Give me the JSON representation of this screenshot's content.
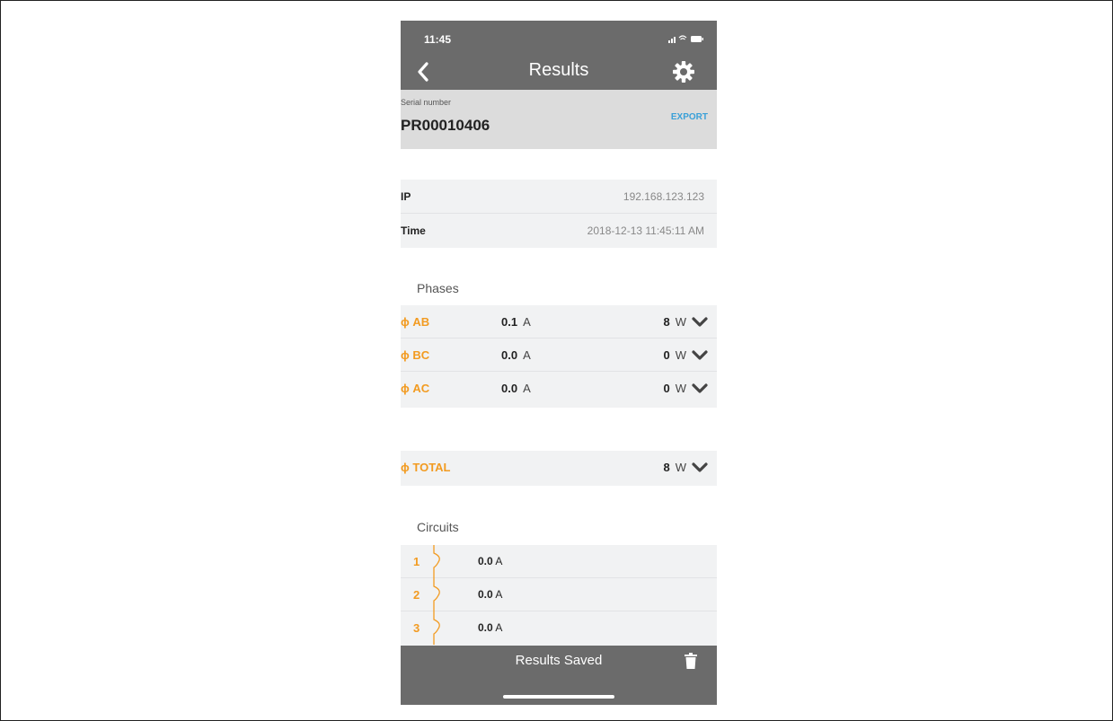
{
  "status_bar": {
    "time": "11:45"
  },
  "nav": {
    "title": "Results"
  },
  "device": {
    "serial_label": "Serial number",
    "serial_value": "PR00010406",
    "export_label": "EXPORT"
  },
  "info": [
    {
      "key": "IP",
      "value": "192.168.123.123"
    },
    {
      "key": "Time",
      "value": "2018-12-13 11:45:11 AM"
    }
  ],
  "phases": {
    "title": "Phases",
    "rows": [
      {
        "name": "AB",
        "amps": "0.1",
        "amps_unit": "A",
        "watts": "8",
        "watts_unit": "W"
      },
      {
        "name": "BC",
        "amps": "0.0",
        "amps_unit": "A",
        "watts": "0",
        "watts_unit": "W"
      },
      {
        "name": "AC",
        "amps": "0.0",
        "amps_unit": "A",
        "watts": "0",
        "watts_unit": "W"
      }
    ]
  },
  "total": {
    "name": "TOTAL",
    "watts": "8",
    "watts_unit": "W"
  },
  "circuits": {
    "title": "Circuits",
    "rows": [
      {
        "num": "1",
        "amps": "0.0",
        "unit": "A"
      },
      {
        "num": "2",
        "amps": "0.0",
        "unit": "A"
      },
      {
        "num": "3",
        "amps": "0.0",
        "unit": "A"
      }
    ]
  },
  "phase_symbol": "ϕ",
  "bottom": {
    "label": "Results Saved"
  },
  "colors": {
    "accent": "#f29b21",
    "bar": "#6b6b6b",
    "link": "#3aa0d8",
    "row_bg": "#f1f2f3",
    "header_bg": "#dcdcdc"
  }
}
